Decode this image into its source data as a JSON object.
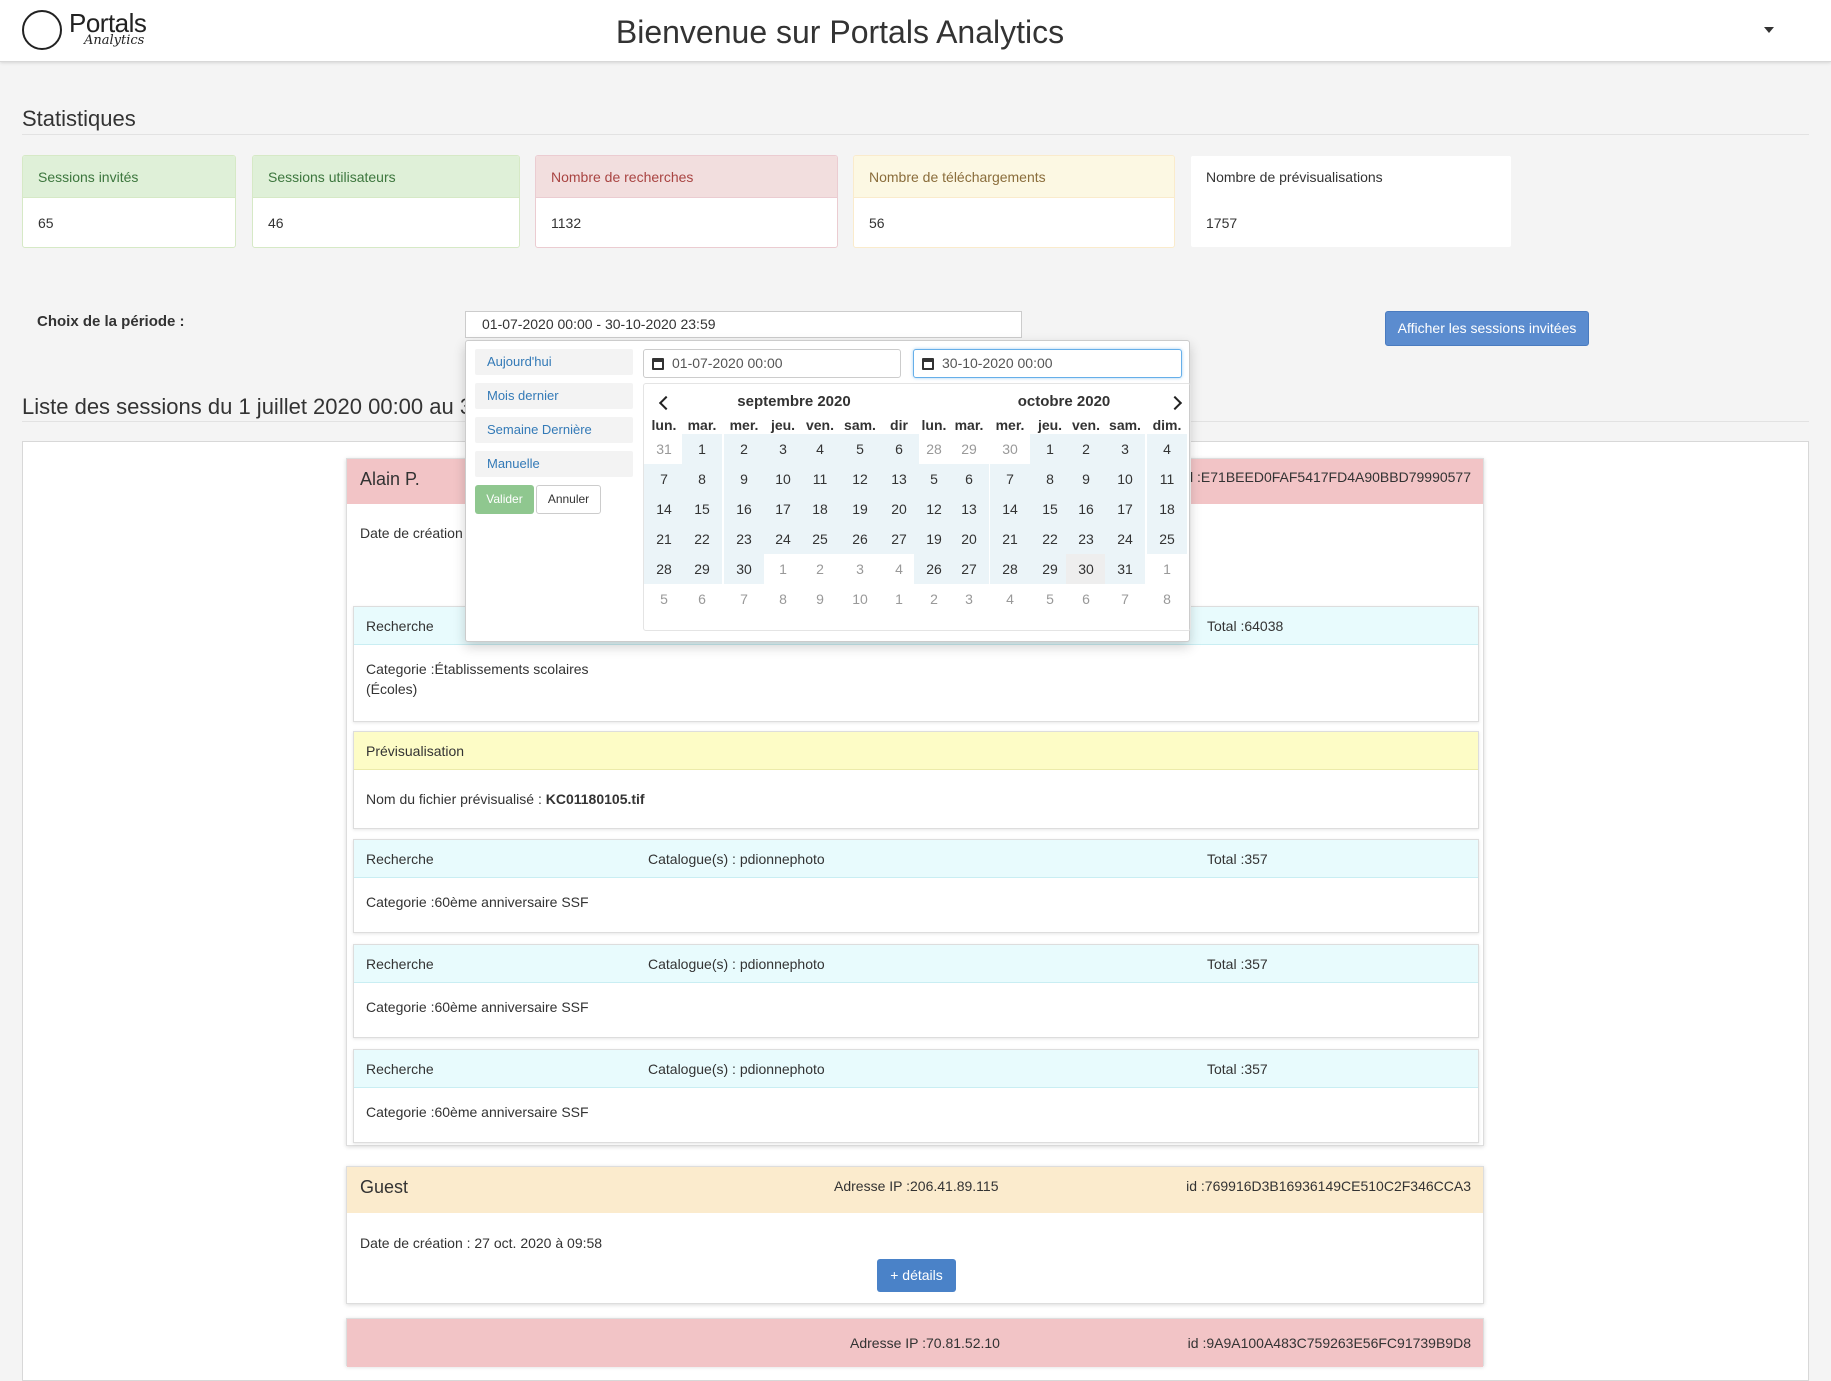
{
  "app": {
    "logo_name": "Portals",
    "logo_sub": "Analytics",
    "title": "Bienvenue sur Portals Analytics"
  },
  "stats": {
    "title": "Statistiques",
    "cards": [
      {
        "label": "Sessions invités",
        "value": "65",
        "color": "#dff0d8"
      },
      {
        "label": "Sessions utilisateurs",
        "value": "46",
        "color": "#dff0d8"
      },
      {
        "label": "Nombre de recherches",
        "value": "1132",
        "color": "#f2dede"
      },
      {
        "label": "Nombre de téléchargements",
        "value": "56",
        "color": "#fcf8e3"
      },
      {
        "label": "Nombre de prévisualisations",
        "value": "1757",
        "color": "#ffffff"
      }
    ]
  },
  "period": {
    "label": "Choix de la période :",
    "value": "01-07-2020 00:00 - 30-10-2020 23:59",
    "guest_button": "Afficher les sessions invitées"
  },
  "list": {
    "title": "Liste des sessions du 1 juillet 2020 00:00 au 30"
  },
  "sessions": [
    {
      "name": "Alain P.",
      "ip": "",
      "id": "id :E71BEED0FAF5417FD4A90BBD79990577",
      "date": "Date de création",
      "header_color": "#f2c4c6",
      "events": [
        {
          "type": "Recherche",
          "catalogue": "",
          "total": "Total :64038",
          "body": "Categorie :Établissements scolaires (Écoles)"
        },
        {
          "type": "Prévisualisation",
          "body_prefix": "Nom du fichier prévisualisé : ",
          "body_file": "KC01180105.tif"
        },
        {
          "type": "Recherche",
          "catalogue": "Catalogue(s) : pdionnephoto",
          "total": "Total :357",
          "body": "Categorie :60ème anniversaire SSF"
        },
        {
          "type": "Recherche",
          "catalogue": "Catalogue(s) : pdionnephoto",
          "total": "Total :357",
          "body": "Categorie :60ème anniversaire SSF"
        },
        {
          "type": "Recherche",
          "catalogue": "Catalogue(s) : pdionnephoto",
          "total": "Total :357",
          "body": "Categorie :60ème anniversaire SSF"
        }
      ]
    },
    {
      "name": "Guest",
      "ip": "Adresse IP :206.41.89.115",
      "id": "id :769916D3B16936149CE510C2F346CCA3",
      "date": "Date de création : 27 oct. 2020 à 09:58",
      "details_button": "+ détails",
      "header_color": "#fbebcd"
    },
    {
      "name": "",
      "ip": "Adresse IP :70.81.52.10",
      "id": "id :9A9A100A483C759263E56FC91739B9D8",
      "header_color": "#f2c4c6"
    }
  ],
  "picker": {
    "ranges": [
      "Aujourd'hui",
      "Mois dernier",
      "Semaine Dernière",
      "Manuelle"
    ],
    "apply": "Valider",
    "cancel": "Annuler",
    "start_input": "01-07-2020 00:00",
    "end_input": "30-10-2020 00:00",
    "dow": [
      "lun.",
      "mar.",
      "mer.",
      "jeu.",
      "ven.",
      "sam.",
      "dim."
    ],
    "dow_left": [
      "lun.",
      "mar.",
      "mer.",
      "jeu.",
      "ven.",
      "sam.",
      "dir"
    ],
    "left": {
      "title": "septembre 2020",
      "weeks": [
        [
          "31",
          "1",
          "2",
          "3",
          "4",
          "5",
          "6"
        ],
        [
          "7",
          "8",
          "9",
          "10",
          "11",
          "12",
          "13"
        ],
        [
          "14",
          "15",
          "16",
          "17",
          "18",
          "19",
          "20"
        ],
        [
          "21",
          "22",
          "23",
          "24",
          "25",
          "26",
          "27"
        ],
        [
          "28",
          "29",
          "30",
          "1",
          "2",
          "3",
          "4"
        ],
        [
          "5",
          "6",
          "7",
          "8",
          "9",
          "10",
          "1"
        ]
      ],
      "off": [
        [
          0,
          0
        ],
        [
          4,
          3
        ],
        [
          4,
          4
        ],
        [
          4,
          5
        ],
        [
          4,
          6
        ],
        [
          5,
          0
        ],
        [
          5,
          1
        ],
        [
          5,
          2
        ],
        [
          5,
          3
        ],
        [
          5,
          4
        ],
        [
          5,
          5
        ],
        [
          5,
          6
        ]
      ]
    },
    "right": {
      "title": "octobre 2020",
      "weeks": [
        [
          "28",
          "29",
          "30",
          "1",
          "2",
          "3",
          "4"
        ],
        [
          "5",
          "6",
          "7",
          "8",
          "9",
          "10",
          "11"
        ],
        [
          "12",
          "13",
          "14",
          "15",
          "16",
          "17",
          "18"
        ],
        [
          "19",
          "20",
          "21",
          "22",
          "23",
          "24",
          "25"
        ],
        [
          "26",
          "27",
          "28",
          "29",
          "30",
          "31",
          "1"
        ],
        [
          "2",
          "3",
          "4",
          "5",
          "6",
          "7",
          "8"
        ]
      ],
      "off": [
        [
          0,
          0
        ],
        [
          0,
          1
        ],
        [
          0,
          2
        ],
        [
          4,
          6
        ],
        [
          5,
          0
        ],
        [
          5,
          1
        ],
        [
          5,
          2
        ],
        [
          5,
          3
        ],
        [
          5,
          4
        ],
        [
          5,
          5
        ],
        [
          5,
          6
        ]
      ],
      "end": [
        4,
        4
      ]
    }
  }
}
